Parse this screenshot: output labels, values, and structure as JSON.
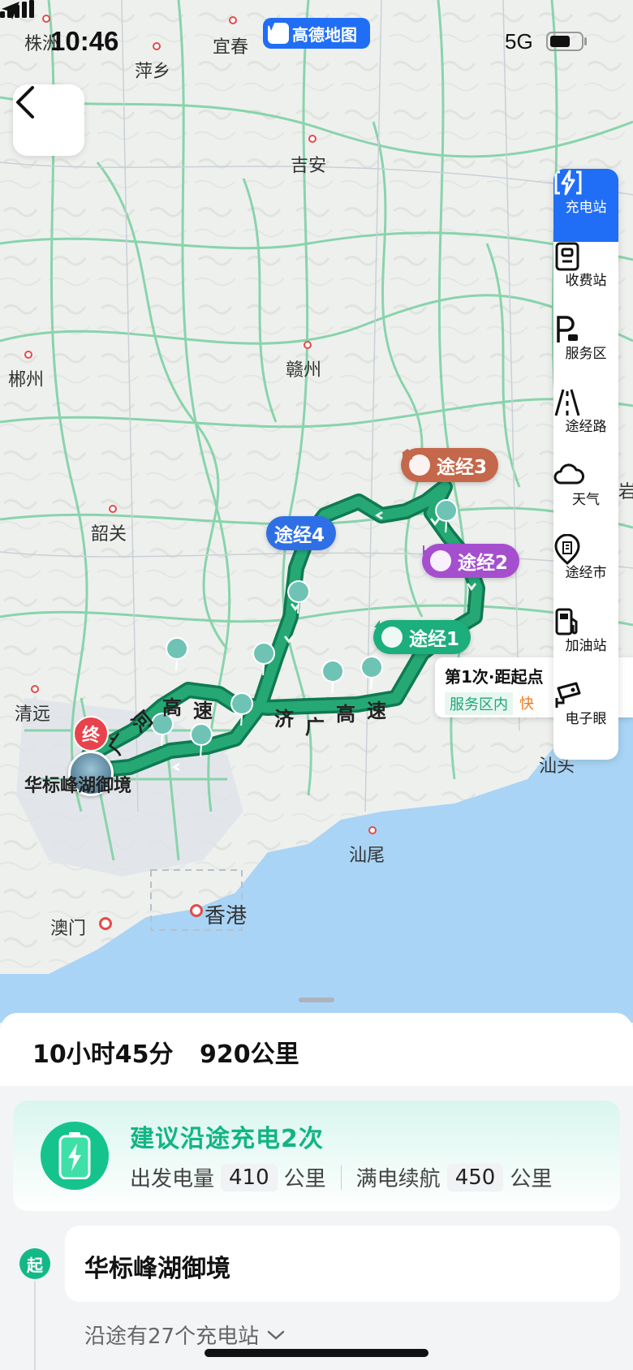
{
  "status_bar": {
    "time": "10:46",
    "network": "5G",
    "brand": "高德地图",
    "battery_level": 0.66
  },
  "map": {
    "cities": [
      {
        "name": "株洲"
      },
      {
        "name": "萍乡"
      },
      {
        "name": "宜春"
      },
      {
        "name": "吉安"
      },
      {
        "name": "郴州"
      },
      {
        "name": "赣州"
      },
      {
        "name": "韶关"
      },
      {
        "name": "清远"
      },
      {
        "name": "汕尾"
      },
      {
        "name": "香港"
      },
      {
        "name": "澳门"
      },
      {
        "name": "汕头"
      },
      {
        "name": "岩"
      }
    ],
    "waypoints": {
      "wp1": "途经1",
      "wp2": "途经2",
      "wp3": "途经3",
      "wp4": "途经4"
    },
    "popup": {
      "title": "第1次·距起点",
      "tag1": "服务区内",
      "tag2": "快"
    },
    "end_marker": "终",
    "destination_label": "华标峰湖御境",
    "road_labels": {
      "r1a": "广",
      "r1b": "河",
      "r1c": "高",
      "r1d": "速",
      "r2a": "济",
      "r2b": "广",
      "r2c": "高",
      "r2d": "速"
    },
    "colors": {
      "route": "#1a9a6a",
      "route_border": "#0f7a52",
      "sea": "#a9d4f5"
    }
  },
  "toolbar": {
    "items": [
      {
        "label": "充电站",
        "icon": "charging-icon",
        "active": true
      },
      {
        "label": "收费站",
        "icon": "toll-icon"
      },
      {
        "label": "服务区",
        "icon": "service-area-icon"
      },
      {
        "label": "途经路",
        "icon": "road-icon"
      },
      {
        "label": "天气",
        "icon": "weather-icon"
      },
      {
        "label": "途经市",
        "icon": "city-icon"
      },
      {
        "label": "加油站",
        "icon": "gas-station-icon"
      },
      {
        "label": "电子眼",
        "icon": "camera-icon"
      }
    ]
  },
  "sheet": {
    "duration": "10小时45分",
    "distance": "920公里",
    "charge": {
      "title": "建议沿途充电2次",
      "depart_label": "出发电量",
      "depart_value": "410",
      "unit": "公里",
      "full_label": "满电续航",
      "full_value": "450"
    },
    "start": {
      "badge": "起",
      "name": "华标峰湖御境"
    },
    "stations_text": "沿途有27个充电站"
  }
}
